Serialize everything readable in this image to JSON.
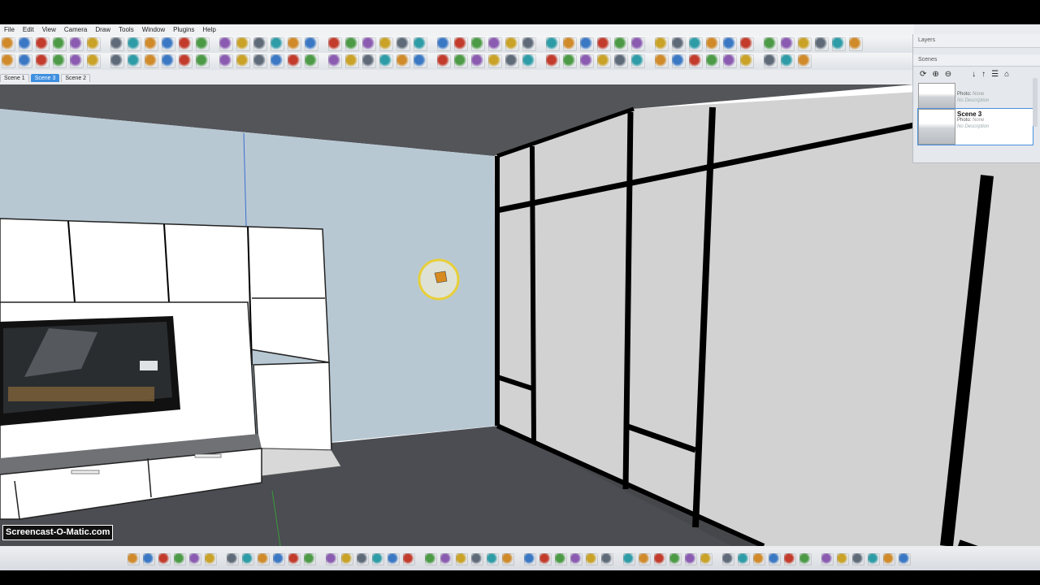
{
  "menu": [
    "File",
    "Edit",
    "View",
    "Camera",
    "Draw",
    "Tools",
    "Window",
    "Plugins",
    "Help"
  ],
  "scene_tabs": [
    {
      "label": "Scene 1",
      "active": false
    },
    {
      "label": "Scene 3",
      "active": true
    },
    {
      "label": "Scene 2",
      "active": false
    }
  ],
  "tray": {
    "layers_title": "Layers",
    "scenes_title": "Scenes",
    "scenes": [
      {
        "name": "",
        "photo_label": "Photo:",
        "photo_value": "None",
        "description": "No Description",
        "selected": false
      },
      {
        "name": "Scene 3",
        "photo_label": "Photo:",
        "photo_value": "None",
        "description": "No Description",
        "selected": true
      }
    ]
  },
  "watermark": "Screencast-O-Matic.com",
  "colors": {
    "wall_blue": "#b8c8d3",
    "floor": "#4b4d52",
    "ceiling": "#535559",
    "right_wall": "#d2d2d2",
    "panel_frame": "#000000",
    "accent_blue": "#3f8fe0"
  },
  "icons": {
    "toolbar1": [
      "select-arrow-icon",
      "paint-bucket-icon",
      "eraser-icon",
      "pencil-icon",
      "line-icon",
      "rectangle-icon",
      "circle-icon",
      "arc-icon",
      "push-pull-icon",
      "move-icon",
      "rotate-icon",
      "scale-icon",
      "offset-icon",
      "tape-measure-icon",
      "protractor-icon",
      "axes-icon",
      "dimension-icon",
      "text-icon",
      "section-plane-icon",
      "orbit-icon",
      "pan-icon",
      "zoom-icon",
      "zoom-extents-icon",
      "component-icon"
    ],
    "toolbar2": [
      "sandbox-icon",
      "smoove-icon",
      "stamp-icon",
      "drape-icon",
      "flip-edge-icon",
      "layer-icon",
      "shadow-icon",
      "fog-icon",
      "style-icon",
      "x-ray-icon",
      "wireframe-icon",
      "hidden-line-icon",
      "shaded-icon",
      "textured-icon",
      "monochrome-icon"
    ],
    "bottom": [
      "orbit-icon",
      "pan-icon",
      "zoom-icon",
      "zoom-window-icon",
      "previous-view-icon",
      "next-view-icon",
      "iso-view-icon",
      "top-view-icon",
      "front-view-icon",
      "right-view-icon",
      "back-view-icon",
      "left-view-icon",
      "x-ray-icon",
      "fog-icon",
      "shadow-icon",
      "record-icon"
    ]
  },
  "tray_tools": [
    "refresh-icon",
    "add-scene-icon",
    "remove-scene-icon",
    "move-down-icon",
    "move-up-icon",
    "view-options-icon",
    "details-icon"
  ]
}
